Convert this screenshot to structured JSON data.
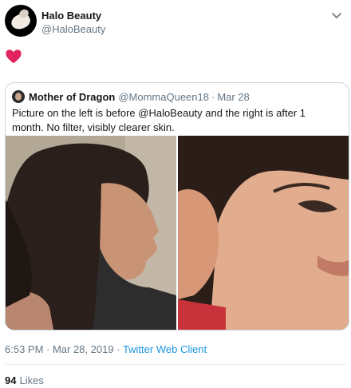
{
  "tweet": {
    "author_name": "Halo Beauty",
    "author_handle": "@HaloBeauty",
    "body_icon": "heart-emoji",
    "time": "6:53 PM · Mar 28, 2019",
    "separator": "·",
    "client": "Twitter Web Client",
    "likes_count": "94",
    "likes_label": "Likes"
  },
  "quoted": {
    "author_name": "Mother of Dragon",
    "author_handle": "@MommaQueen18",
    "separator": "·",
    "date": "Mar 28",
    "text": "Picture on the left is before @HaloBeauty and the right is after 1 month. No filter, visibly clearer skin."
  },
  "colors": {
    "heart": "#e0245e",
    "link": "#1b95e0",
    "secondary_text": "#657786",
    "border": "#ccd6dd"
  }
}
